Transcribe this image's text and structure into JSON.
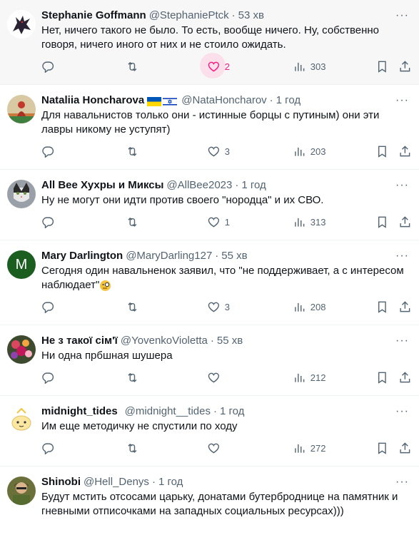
{
  "tweets": [
    {
      "name": "Stephanie Goffmann",
      "handle": "@StephaniePtck",
      "time": "53 хв",
      "text": "Нет, ничего такого не было. То есть, вообще ничего. Ну, собственно говоря, ничего иного от них и не стоило ожидать.",
      "likes": "2",
      "views": "303",
      "avatar_icon": "dragon-avatar"
    },
    {
      "name": "Nataliia Honcharova",
      "handle": "@NataHoncharov",
      "time": "1 год",
      "text": "Для навальнистов только они - истинные борцы с путиным) они эти лавры никому не уступят)",
      "likes": "3",
      "views": "203",
      "avatar_icon": "person-field-avatar"
    },
    {
      "name": "All Bee Хухры и Миксы",
      "handle": "@AllBee2023",
      "time": "1 год",
      "text": "Ну не могут они идти против своего \"нородца\" и их СВО.",
      "likes": "1",
      "views": "313",
      "avatar_icon": "cat-avatar"
    },
    {
      "name": "Mary Darlington",
      "handle": "@MaryDarling127",
      "time": "55 хв",
      "text": "Сегодня один навальненок заявил, что \"не поддерживает, а с интересом наблюдает\"",
      "likes": "3",
      "views": "208",
      "avatar_letter": "M",
      "avatar_color": "#1b5e20"
    },
    {
      "name": "Не з такої сім'ї",
      "handle": "@YovenkoVioletta",
      "time": "55 хв",
      "text": "Ни одна прбшная шушера",
      "likes": "",
      "views": "212",
      "avatar_icon": "flowers-avatar"
    },
    {
      "name": "midnight_tides",
      "handle": "@midnight__tides",
      "time": "1 год",
      "text": "Им еще методичку не спустили по ходу",
      "likes": "",
      "views": "272",
      "avatar_icon": "egg-character-avatar"
    },
    {
      "name": "Shinobi",
      "handle": "@Hell_Denys",
      "time": "1 год",
      "text": "Будут мстить отсосами царьку, донатами бутерброднице на памятник и гневными отписочками на западных социальных ресурсах)))",
      "likes": "",
      "views": "",
      "avatar_icon": "soldier-avatar"
    }
  ],
  "more_label": "···",
  "colors": {
    "like_active": "#f91880",
    "muted": "#536471",
    "text": "#0f1419"
  }
}
